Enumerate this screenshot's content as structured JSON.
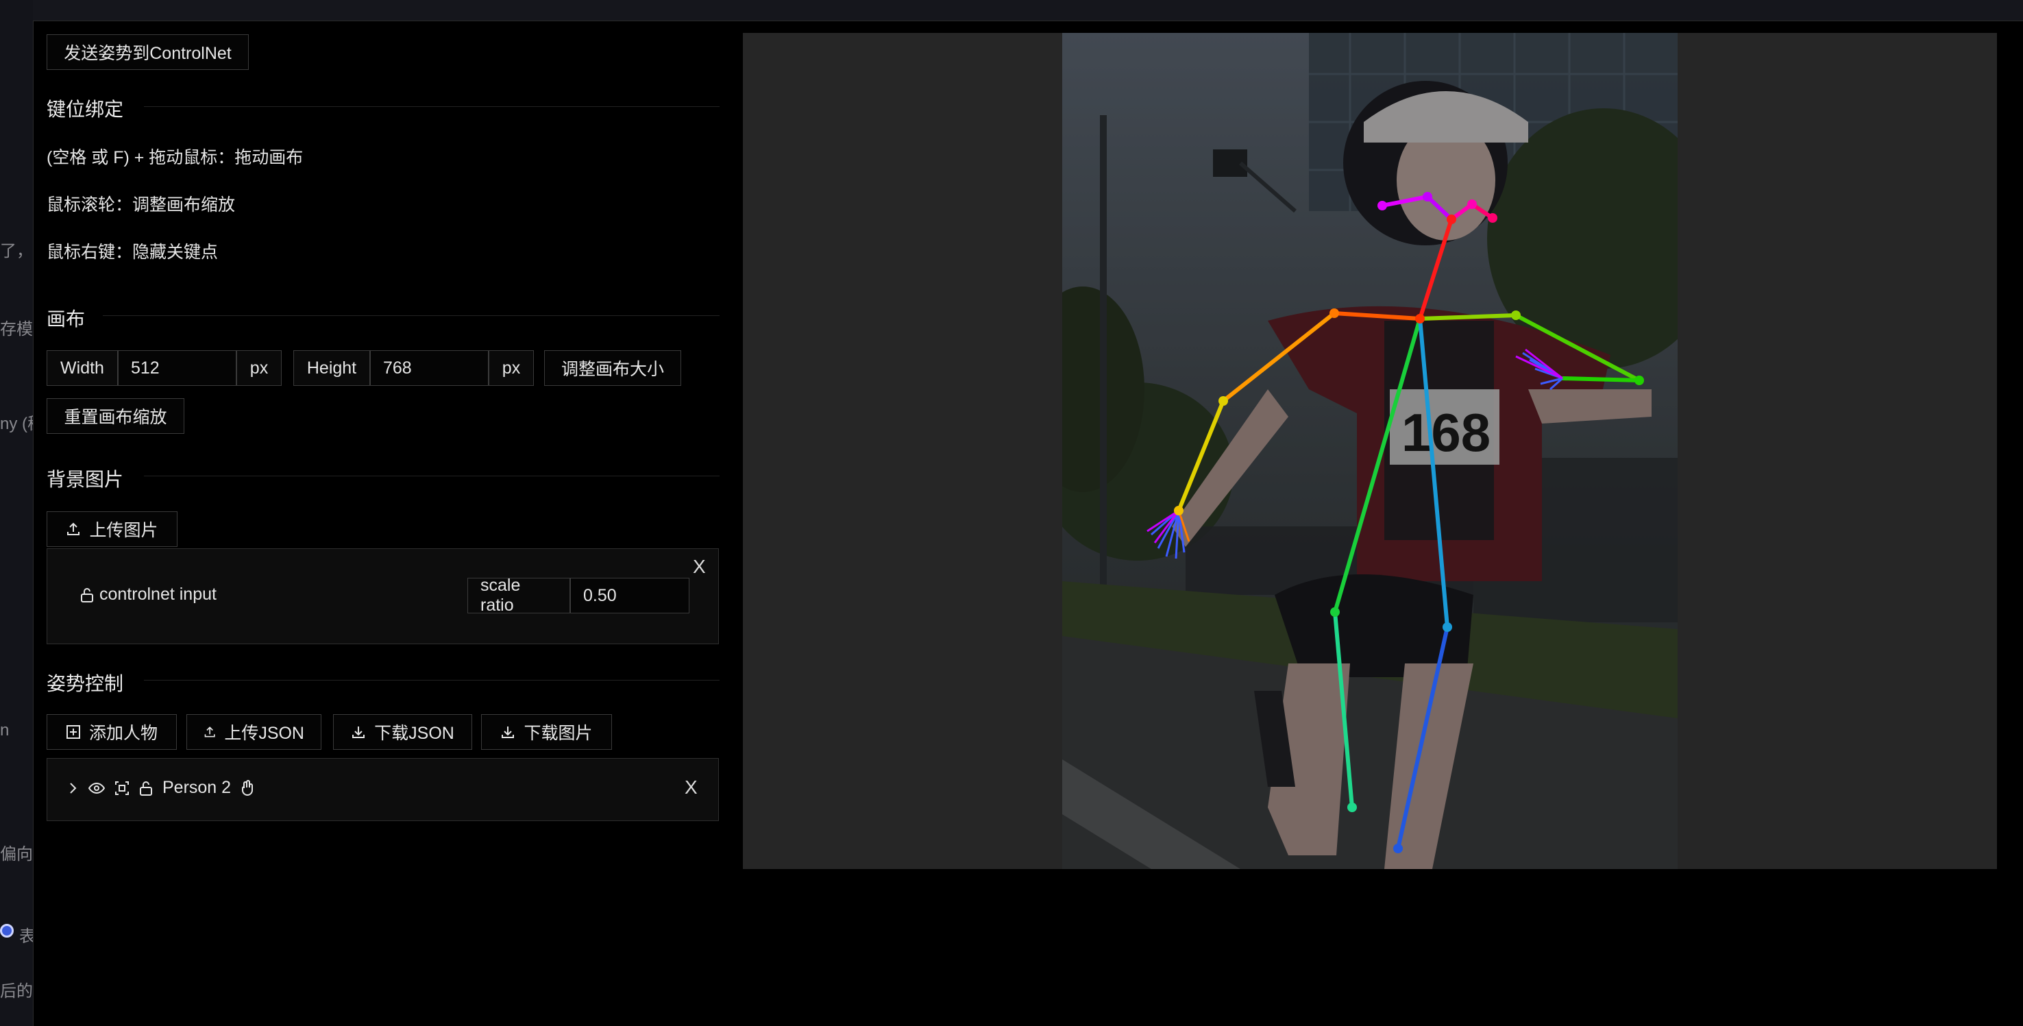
{
  "background_left": {
    "fragments": [
      "了，请",
      "存模",
      "ny (稳",
      "n",
      "偏向指",
      "表",
      "后的数"
    ]
  },
  "toolbar": {
    "send_pose_label": "发送姿势到ControlNet"
  },
  "keybindings": {
    "title": "键位绑定",
    "lines": [
      "(空格 或 F) + 拖动鼠标：拖动画布",
      "鼠标滚轮：调整画布缩放",
      "鼠标右键：隐藏关键点"
    ]
  },
  "canvas": {
    "title": "画布",
    "width_label": "Width",
    "width_value": "512",
    "height_label": "Height",
    "height_value": "768",
    "unit": "px",
    "resize_label": "调整画布大小",
    "reset_zoom_label": "重置画布缩放"
  },
  "background_image": {
    "title": "背景图片",
    "upload_label": "上传图片",
    "item_name": "controlnet input",
    "scale_label": "scale ratio",
    "scale_value": "0.50",
    "close": "X"
  },
  "pose_control": {
    "title": "姿势控制",
    "add_person_label": "添加人物",
    "upload_json_label": "上传JSON",
    "download_json_label": "下载JSON",
    "download_image_label": "下载图片",
    "person_name": "Person 2",
    "close": "X"
  },
  "preview": {
    "bib_number": "168"
  },
  "colors": {
    "accent": "#3b5bdb",
    "panel_bg": "#0d0d0d",
    "preview_bg": "#262626"
  }
}
